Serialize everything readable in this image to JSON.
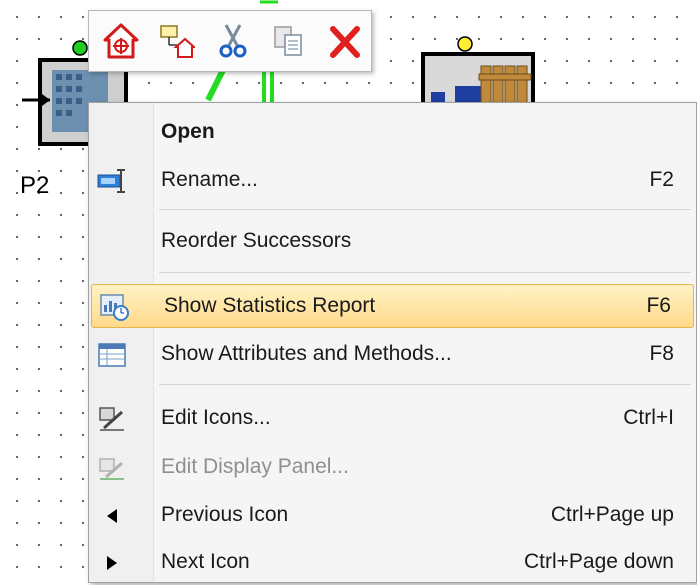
{
  "canvas": {
    "node_label": "P2"
  },
  "toolbar": {
    "buttons": [
      {
        "name": "open-location-icon"
      },
      {
        "name": "open-origin-icon"
      },
      {
        "name": "cut-icon"
      },
      {
        "name": "copy-icon"
      },
      {
        "name": "delete-icon"
      }
    ]
  },
  "menu": {
    "items": [
      {
        "label": "Open",
        "shortcut": "",
        "bold": true
      },
      {
        "label": "Rename...",
        "shortcut": "F2"
      },
      {
        "label": "Reorder Successors",
        "shortcut": ""
      },
      {
        "label": "Show Statistics Report",
        "shortcut": "F6",
        "highlighted": true
      },
      {
        "label": "Show Attributes and Methods...",
        "shortcut": "F8"
      },
      {
        "label": "Edit Icons...",
        "shortcut": "Ctrl+I"
      },
      {
        "label": "Edit Display Panel...",
        "shortcut": "",
        "disabled": true
      },
      {
        "label": "Previous Icon",
        "shortcut": "Ctrl+Page up"
      },
      {
        "label": "Next Icon",
        "shortcut": "Ctrl+Page down"
      }
    ]
  },
  "colors": {
    "highlight_top": "#fff3c6",
    "highlight_bottom": "#ffd98a",
    "highlight_border": "#e5b44a",
    "connector_green": "#22dd22"
  }
}
